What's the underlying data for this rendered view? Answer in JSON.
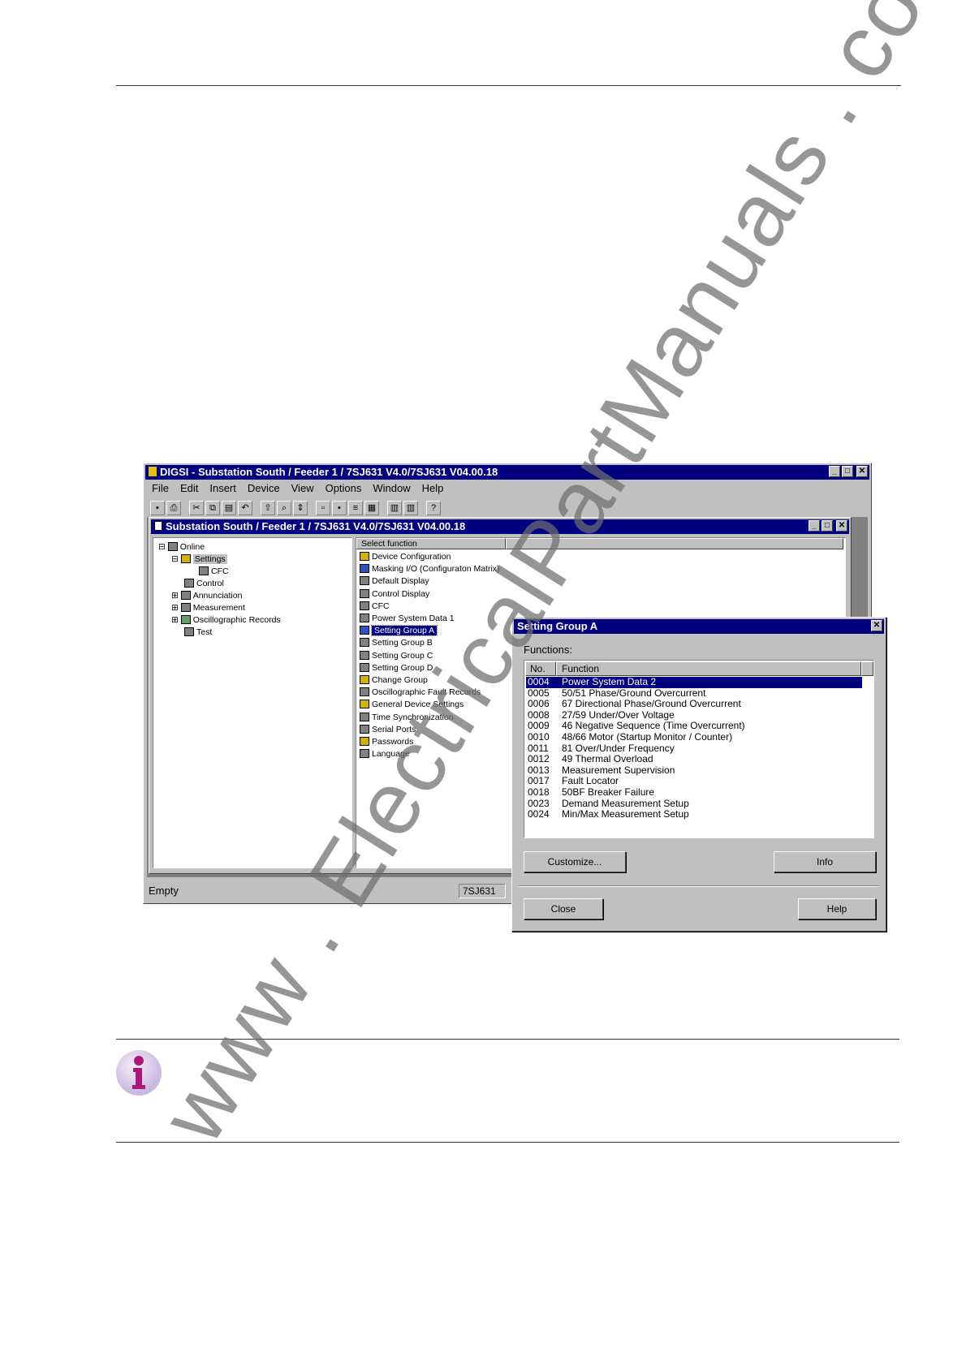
{
  "main_window": {
    "title": "DIGSI - Substation South / Feeder 1 / 7SJ631 V4.0/7SJ631 V04.00.18",
    "menu": [
      "File",
      "Edit",
      "Insert",
      "Device",
      "View",
      "Options",
      "Window",
      "Help"
    ],
    "status_left": "Empty",
    "status_right": "7SJ631"
  },
  "child_window": {
    "title": "Substation South / Feeder 1 / 7SJ631 V4.0/7SJ631 V04.00.18",
    "tree": [
      "Online",
      "Settings",
      "CFC",
      "Control",
      "Annunciation",
      "Measurement",
      "Oscillographic Records",
      "Test"
    ],
    "list_header": "Select function",
    "functions": [
      "Device Configuration",
      "Masking I/O (Configuraton Matrix)",
      "Default Display",
      "Control Display",
      "CFC",
      "Power System Data 1",
      "Setting Group A",
      "Setting Group B",
      "Setting Group C",
      "Setting Group D",
      "Change Group",
      "Oscillographic Fault Records",
      "General Device Settings",
      "Time Synchronization",
      "Serial Ports",
      "Passwords",
      "Language"
    ]
  },
  "dialog": {
    "title": "Setting Group A",
    "functions_label": "Functions:",
    "col_no": "No.",
    "col_function": "Function",
    "rows": [
      {
        "no": "0004",
        "fn": "Power System Data 2"
      },
      {
        "no": "0005",
        "fn": "50/51 Phase/Ground Overcurrent"
      },
      {
        "no": "0006",
        "fn": "67 Directional Phase/Ground Overcurrent"
      },
      {
        "no": "0008",
        "fn": "27/59 Under/Over Voltage"
      },
      {
        "no": "0009",
        "fn": "46  Negative Sequence (Time Overcurrent)"
      },
      {
        "no": "0010",
        "fn": "48/66 Motor (Startup Monitor / Counter)"
      },
      {
        "no": "0011",
        "fn": "81 Over/Under Frequency"
      },
      {
        "no": "0012",
        "fn": "49 Thermal Overload"
      },
      {
        "no": "0013",
        "fn": "Measurement Supervision"
      },
      {
        "no": "0017",
        "fn": "Fault Locator"
      },
      {
        "no": "0018",
        "fn": "50BF Breaker Failure"
      },
      {
        "no": "0023",
        "fn": "Demand Measurement Setup"
      },
      {
        "no": "0024",
        "fn": "Min/Max Measurement Setup"
      }
    ],
    "customize": "Customize...",
    "info": "Info",
    "close": "Close",
    "help": "Help"
  },
  "watermark": "www . ElectricalPartManuals . com"
}
